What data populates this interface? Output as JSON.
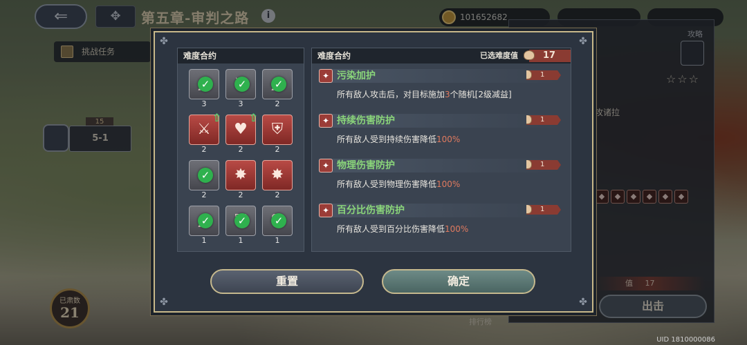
{
  "header": {
    "back_icon": "back-arrow-icon",
    "menu_icon": "grid-menu-icon",
    "chapter_title": "第五章-审判之路",
    "info_symbol": "i",
    "currency_value": "101652682"
  },
  "map": {
    "task_button_label": "挑战任务",
    "stage_number": "15",
    "stage_label": "5-1"
  },
  "side_panel": {
    "attack_label": "攻略",
    "stars": "☆☆☆",
    "hint_text": "攻诸拉",
    "mini_icons": [
      "◆",
      "◆",
      "◆",
      "◆",
      "◆",
      "◆"
    ],
    "difficulty_label": "值",
    "difficulty_value": "17",
    "fight_button": "出击"
  },
  "bottom": {
    "level_label": "已肃数",
    "level_value": "21",
    "rank_label": "排行榜",
    "uid": "UID 1810000086"
  },
  "modal": {
    "left_header": "难度合约",
    "right_header": "难度合约",
    "selected_label": "已选难度值",
    "selected_value": "17",
    "contracts": [
      {
        "glyph": "▲",
        "color": "grey",
        "checked": true,
        "upgrade": false,
        "level": "3"
      },
      {
        "glyph": "⚔",
        "color": "grey",
        "checked": true,
        "upgrade": false,
        "level": "3"
      },
      {
        "glyph": "▲",
        "color": "grey",
        "checked": true,
        "upgrade": false,
        "level": "2"
      },
      {
        "glyph": "⚔",
        "color": "red",
        "checked": false,
        "upgrade": true,
        "level": "2"
      },
      {
        "glyph": "♥",
        "color": "red",
        "checked": false,
        "upgrade": true,
        "level": "2"
      },
      {
        "glyph": "⛨",
        "color": "red",
        "checked": false,
        "upgrade": false,
        "level": "2"
      },
      {
        "glyph": "✸",
        "color": "grey",
        "checked": true,
        "upgrade": false,
        "level": "2"
      },
      {
        "glyph": "✸",
        "color": "red",
        "checked": false,
        "upgrade": false,
        "level": "2"
      },
      {
        "glyph": "✸",
        "color": "red",
        "checked": false,
        "upgrade": false,
        "level": "2"
      },
      {
        "glyph": "▲",
        "color": "grey",
        "checked": true,
        "upgrade": false,
        "level": "1"
      },
      {
        "glyph": "⛨",
        "color": "grey",
        "checked": true,
        "upgrade": false,
        "level": "1"
      },
      {
        "glyph": "♥",
        "color": "grey",
        "checked": true,
        "upgrade": false,
        "level": "1"
      }
    ],
    "clauses": [
      {
        "name": "污染加护",
        "points": "1",
        "desc_before": "所有敌人攻击后，对目标施加",
        "desc_hl": "3",
        "desc_after": "个随机[2级减益]"
      },
      {
        "name": "持续伤害防护",
        "points": "1",
        "desc_before": "所有敌人受到持续伤害降低",
        "desc_hl": "100%",
        "desc_after": ""
      },
      {
        "name": "物理伤害防护",
        "points": "1",
        "desc_before": "所有敌人受到物理伤害降低",
        "desc_hl": "100%",
        "desc_after": ""
      },
      {
        "name": "百分比伤害防护",
        "points": "1",
        "desc_before": "所有敌人受到百分比伤害降低",
        "desc_hl": "100%",
        "desc_after": ""
      }
    ],
    "reset_button": "重置",
    "confirm_button": "确定"
  },
  "colors": {
    "accent_gold": "#c9b98a",
    "clause_green": "#8ad57a",
    "highlight_red": "#e07a5f",
    "check_green": "#2fb14e"
  }
}
